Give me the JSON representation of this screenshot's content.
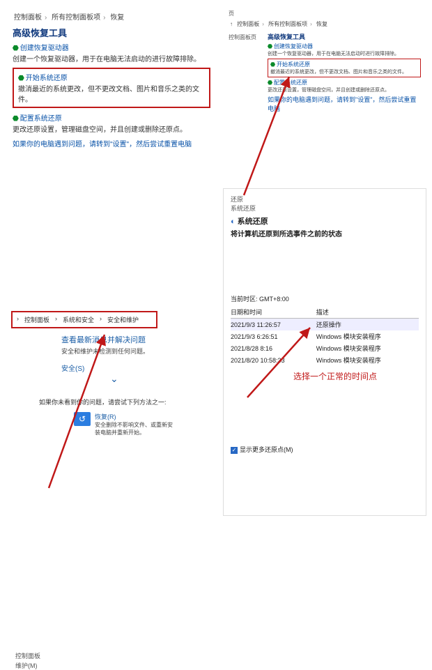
{
  "p1": {
    "crumbs": [
      "控制面板",
      "所有控制面板项",
      "恢复"
    ],
    "heading": "高级恢复工具",
    "b1": {
      "title": "创建恢复驱动器",
      "desc": "创建一个恢复驱动器，用于在电脑无法启动的进行故障排除。"
    },
    "b2": {
      "title": "开始系统还原",
      "desc": "撤消最近的系统更改，但不更改文档、图片和音乐之类的文件。"
    },
    "b3": {
      "title": "配置系统还原",
      "desc": "更改还原设置，管理磁盘空间，并且创建或删除还原点。"
    },
    "b4": {
      "title": "如果你的电脑遇到问题，请转到\"设置\"，然后尝试重置电脑"
    }
  },
  "p2": {
    "hdr": "页",
    "crumbs": [
      "↑",
      "控制面板",
      "所有控制面板项",
      "恢复"
    ],
    "side": "控制面板页",
    "heading": "高级恢复工具",
    "b1": {
      "title": "创建恢复驱动器",
      "desc": "创建一个恢复驱动器，用于在电脑无法启动时进行故障排除。"
    },
    "b2": {
      "title": "开始系统还原",
      "desc": "撤消最近的系统更改，但不更改文档、图片和音乐之类的文件。"
    },
    "b3": {
      "title": "配置系统还原",
      "desc": "更改还原设置，管理磁盘空间，并且创建或删除还原点。"
    },
    "b4": {
      "title": "如果你的电脑遇到问题，请转到\"设置\"，然后尝试重置电脑"
    }
  },
  "p3": {
    "tabs": [
      "控制面板",
      "系统和安全",
      "安全和维护"
    ],
    "side1": "控制面板",
    "side2": "维护(M)",
    "blue": "查看最新消息并解决问题",
    "sub": "安全和维护未检测到任何问题。",
    "sec": "安全(S)",
    "hint": "如果你未看到你的问题，请尝试下列方法之一:",
    "rec": {
      "title": "恢复(R)",
      "l1": "安全删除不影响文件、或重新安",
      "l2": "装电脑并重新开始。"
    }
  },
  "p4": {
    "small1": "还原",
    "small2": "系统还原",
    "title": "系统还原",
    "sub": "将计算机还原到所选事件之前的状态",
    "tz": "当前时区: GMT+8:00",
    "cols": [
      "日期和时间",
      "描述"
    ],
    "rows": [
      {
        "d": "2021/9/3 11:26:57",
        "t": "还原操作"
      },
      {
        "d": "2021/9/3 6:26:51",
        "t": "Windows 模块安装程序"
      },
      {
        "d": "2021/8/28 8:16",
        "t": "Windows 模块安装程序"
      },
      {
        "d": "2021/8/20 10:58:33",
        "t": "Windows 模块安装程序"
      }
    ],
    "ann": "选择一个正常的时间点",
    "more": "显示更多还原点(M)"
  }
}
